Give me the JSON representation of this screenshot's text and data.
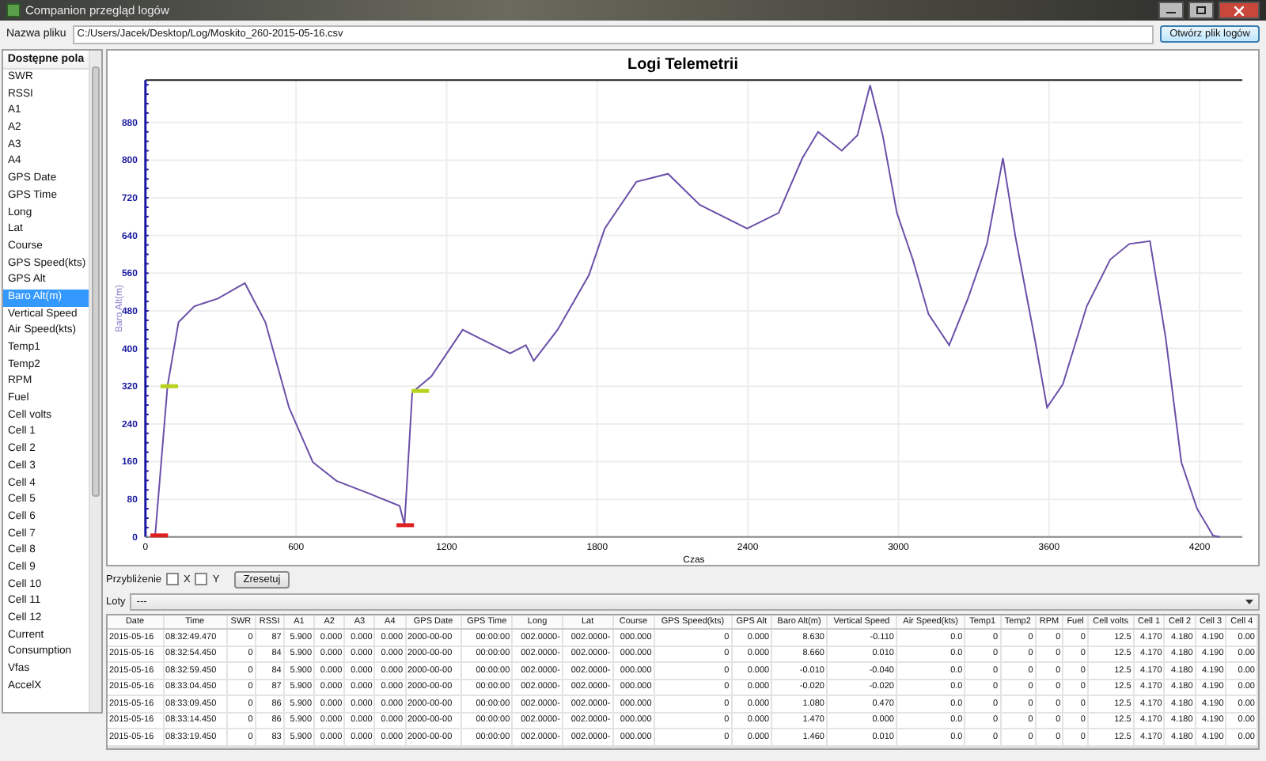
{
  "window": {
    "title": "Companion przegląd logów"
  },
  "file": {
    "label": "Nazwa pliku",
    "value": "C:/Users/Jacek/Desktop/Log/Moskito_260-2015-05-16.csv",
    "button": "Otwórz plik logów"
  },
  "fields": {
    "header": "Dostępne pola",
    "items": [
      {
        "label": "SWR",
        "selected": false
      },
      {
        "label": "RSSI",
        "selected": false
      },
      {
        "label": "A1",
        "selected": false
      },
      {
        "label": "A2",
        "selected": false
      },
      {
        "label": "A3",
        "selected": false
      },
      {
        "label": "A4",
        "selected": false
      },
      {
        "label": "GPS Date",
        "selected": false
      },
      {
        "label": "GPS Time",
        "selected": false
      },
      {
        "label": "Long",
        "selected": false
      },
      {
        "label": "Lat",
        "selected": false
      },
      {
        "label": "Course",
        "selected": false
      },
      {
        "label": "GPS Speed(kts)",
        "selected": false
      },
      {
        "label": "GPS Alt",
        "selected": false
      },
      {
        "label": "Baro Alt(m)",
        "selected": true
      },
      {
        "label": "Vertical Speed",
        "selected": false
      },
      {
        "label": "Air Speed(kts)",
        "selected": false
      },
      {
        "label": "Temp1",
        "selected": false
      },
      {
        "label": "Temp2",
        "selected": false
      },
      {
        "label": "RPM",
        "selected": false
      },
      {
        "label": "Fuel",
        "selected": false
      },
      {
        "label": "Cell volts",
        "selected": false
      },
      {
        "label": "Cell 1",
        "selected": false
      },
      {
        "label": "Cell 2",
        "selected": false
      },
      {
        "label": "Cell 3",
        "selected": false
      },
      {
        "label": "Cell 4",
        "selected": false
      },
      {
        "label": "Cell 5",
        "selected": false
      },
      {
        "label": "Cell 6",
        "selected": false
      },
      {
        "label": "Cell 7",
        "selected": false
      },
      {
        "label": "Cell 8",
        "selected": false
      },
      {
        "label": "Cell 9",
        "selected": false
      },
      {
        "label": "Cell 10",
        "selected": false
      },
      {
        "label": "Cell 11",
        "selected": false
      },
      {
        "label": "Cell 12",
        "selected": false
      },
      {
        "label": "Current",
        "selected": false
      },
      {
        "label": "Consumption",
        "selected": false
      },
      {
        "label": "Vfas",
        "selected": false
      },
      {
        "label": "AccelX",
        "selected": false
      }
    ]
  },
  "chart": {
    "chart_data": {
      "type": "line",
      "title": "Logi Telemetrii",
      "xlabel": "Czas",
      "ylabel": "Baro Alt(m)",
      "x": [
        38,
        88,
        132,
        195,
        289,
        396,
        478,
        572,
        667,
        761,
        887,
        1013,
        1032,
        1063,
        1139,
        1264,
        1327,
        1453,
        1516,
        1547,
        1642,
        1767,
        1830,
        1956,
        2082,
        2208,
        2397,
        2523,
        2617,
        2680,
        2774,
        2837,
        2887,
        2937,
        2994,
        3057,
        3120,
        3202,
        3277,
        3353,
        3416,
        3466,
        3542,
        3592,
        3655,
        3750,
        3844,
        3920,
        4002,
        4064,
        4127,
        4190,
        4253,
        4280
      ],
      "series": [
        {
          "color": "#6a4fa8",
          "values": [
            0,
            320,
            456,
            490,
            506,
            539,
            456,
            275,
            159,
            119,
            93,
            66,
            26,
            307,
            341,
            440,
            423,
            390,
            407,
            374,
            440,
            556,
            655,
            754,
            771,
            705,
            655,
            688,
            804,
            860,
            820,
            853,
            959,
            853,
            688,
            589,
            473,
            407,
            506,
            622,
            804,
            638,
            424,
            275,
            324,
            490,
            589,
            622,
            628,
            424,
            159,
            60,
            3,
            0
          ]
        }
      ],
      "grid": true,
      "xlim": [
        0,
        4370
      ],
      "ylim": [
        0,
        970
      ],
      "xticks": [
        0,
        600,
        1200,
        1800,
        2400,
        3000,
        3600,
        4200
      ],
      "yticks": [
        0,
        80,
        160,
        240,
        320,
        400,
        480,
        560,
        640,
        720,
        800,
        880
      ]
    }
  },
  "zoom": {
    "label": "Przybliżenie",
    "options": [
      {
        "label": "X",
        "checked": false
      },
      {
        "label": "Y",
        "checked": false
      }
    ],
    "button": "Zresetuj"
  },
  "flights": {
    "label": "Loty",
    "value": "---"
  },
  "table": {
    "columns": [
      "Date",
      "Time",
      "SWR",
      "RSSI",
      "A1",
      "A2",
      "A3",
      "A4",
      "GPS Date",
      "GPS Time",
      "Long",
      "Lat",
      "Course",
      "GPS Speed(kts)",
      "GPS Alt",
      "Baro Alt(m)",
      "Vertical Speed",
      "Air Speed(kts)",
      "Temp1",
      "Temp2",
      "RPM",
      "Fuel",
      "Cell volts",
      "Cell 1",
      "Cell 2",
      "Cell 3",
      "Cell 4"
    ],
    "rows": [
      [
        "2015-05-16",
        "08:32:49.470",
        "0",
        "87",
        "5.900",
        "0.000",
        "0.000",
        "0.000",
        "2000-00-00",
        "00:00:00",
        "002.0000-",
        "002.0000-",
        "000.000",
        "0",
        "0.000",
        "8.630",
        "-0.110",
        "0.0",
        "0",
        "0",
        "0",
        "0",
        "12.5",
        "4.170",
        "4.180",
        "4.190",
        "0.00"
      ],
      [
        "2015-05-16",
        "08:32:54.450",
        "0",
        "84",
        "5.900",
        "0.000",
        "0.000",
        "0.000",
        "2000-00-00",
        "00:00:00",
        "002.0000-",
        "002.0000-",
        "000.000",
        "0",
        "0.000",
        "8.660",
        "0.010",
        "0.0",
        "0",
        "0",
        "0",
        "0",
        "12.5",
        "4.170",
        "4.180",
        "4.190",
        "0.00"
      ],
      [
        "2015-05-16",
        "08:32:59.450",
        "0",
        "84",
        "5.900",
        "0.000",
        "0.000",
        "0.000",
        "2000-00-00",
        "00:00:00",
        "002.0000-",
        "002.0000-",
        "000.000",
        "0",
        "0.000",
        "-0.010",
        "-0.040",
        "0.0",
        "0",
        "0",
        "0",
        "0",
        "12.5",
        "4.170",
        "4.180",
        "4.190",
        "0.00"
      ],
      [
        "2015-05-16",
        "08:33:04.450",
        "0",
        "87",
        "5.900",
        "0.000",
        "0.000",
        "0.000",
        "2000-00-00",
        "00:00:00",
        "002.0000-",
        "002.0000-",
        "000.000",
        "0",
        "0.000",
        "-0.020",
        "-0.020",
        "0.0",
        "0",
        "0",
        "0",
        "0",
        "12.5",
        "4.170",
        "4.180",
        "4.190",
        "0.00"
      ],
      [
        "2015-05-16",
        "08:33:09.450",
        "0",
        "86",
        "5.900",
        "0.000",
        "0.000",
        "0.000",
        "2000-00-00",
        "00:00:00",
        "002.0000-",
        "002.0000-",
        "000.000",
        "0",
        "0.000",
        "1.080",
        "0.470",
        "0.0",
        "0",
        "0",
        "0",
        "0",
        "12.5",
        "4.170",
        "4.180",
        "4.190",
        "0.00"
      ],
      [
        "2015-05-16",
        "08:33:14.450",
        "0",
        "86",
        "5.900",
        "0.000",
        "0.000",
        "0.000",
        "2000-00-00",
        "00:00:00",
        "002.0000-",
        "002.0000-",
        "000.000",
        "0",
        "0.000",
        "1.470",
        "0.000",
        "0.0",
        "0",
        "0",
        "0",
        "0",
        "12.5",
        "4.170",
        "4.180",
        "4.190",
        "0.00"
      ],
      [
        "2015-05-16",
        "08:33:19.450",
        "0",
        "83",
        "5.900",
        "0.000",
        "0.000",
        "0.000",
        "2000-00-00",
        "00:00:00",
        "002.0000-",
        "002.0000-",
        "000.000",
        "0",
        "0.000",
        "1.460",
        "0.010",
        "0.0",
        "0",
        "0",
        "0",
        "0",
        "12.5",
        "4.170",
        "4.180",
        "4.190",
        "0.00"
      ]
    ]
  }
}
